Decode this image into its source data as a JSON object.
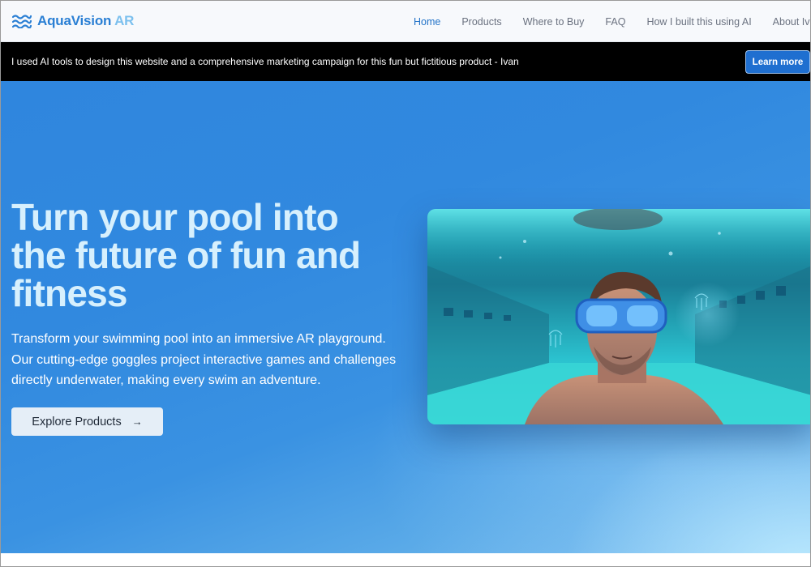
{
  "brand": {
    "name": "AquaVision",
    "suffix": "AR",
    "logo_icon": "waves-icon"
  },
  "nav": {
    "items": [
      {
        "label": "Home",
        "active": true
      },
      {
        "label": "Products",
        "active": false
      },
      {
        "label": "Where to Buy",
        "active": false
      },
      {
        "label": "FAQ",
        "active": false
      },
      {
        "label": "How I built this using AI",
        "active": false
      },
      {
        "label": "About Ivan",
        "active": false
      }
    ]
  },
  "banner": {
    "text": "I used AI tools to design this website and a comprehensive marketing campaign for this fun but fictitious product - Ivan",
    "button_label": "Learn more"
  },
  "hero": {
    "title_lines": [
      "Turn your pool into",
      "the future of fun and",
      "fitness"
    ],
    "description_lines": [
      "Transform your swimming pool into an immersive AR playground.",
      "Our cutting-edge goggles project interactive games and challenges",
      "directly underwater, making every swim an adventure."
    ],
    "cta_label": "Explore Products",
    "cta_icon": "arrow-right-icon",
    "image_subject": "swimmer-underwater-with-ar-goggles"
  },
  "colors": {
    "brand": "#2a7fd4",
    "brand_light": "#7cc0ee",
    "nav_active": "#2474c8",
    "banner_bg": "#000000",
    "banner_button": "#1f6fd0",
    "hero_bg": "#3189df",
    "hero_title": "#d7f0fd"
  }
}
